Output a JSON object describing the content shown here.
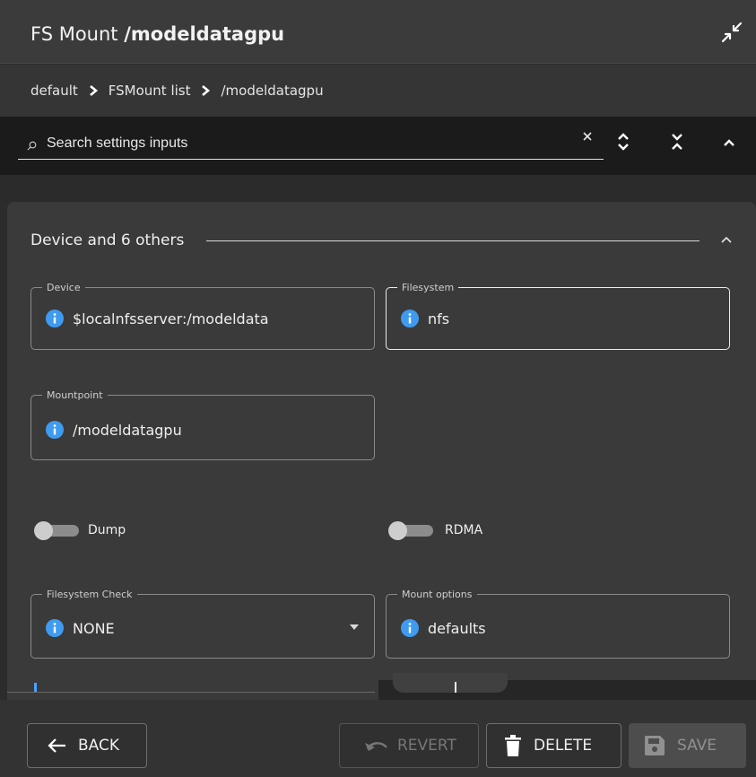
{
  "window": {
    "title_prefix": "FS Mount ",
    "title_name": "/modeldatagpu",
    "collapse_icon": "collapse-arrows-icon"
  },
  "breadcrumb": {
    "items": [
      "default",
      "FSMount list",
      "/modeldatagpu"
    ]
  },
  "search": {
    "placeholder": "Search settings inputs",
    "value": ""
  },
  "section": {
    "title": "Device and 6 others"
  },
  "fields": {
    "device": {
      "label": "Device",
      "value": "$localnfsserver:/modeldata"
    },
    "filesystem": {
      "label": "Filesystem",
      "value": "nfs"
    },
    "mountpoint": {
      "label": "Mountpoint",
      "value": "/modeldatagpu"
    },
    "filesystem_check": {
      "label": "Filesystem Check",
      "value": "NONE"
    },
    "mount_options": {
      "label": "Mount options",
      "value": "defaults"
    }
  },
  "toggles": {
    "dump": {
      "label": "Dump",
      "on": false
    },
    "rdma": {
      "label": "RDMA",
      "on": false
    }
  },
  "footer": {
    "back_label": "BACK",
    "revert_label": "REVERT",
    "delete_label": "DELETE",
    "save_label": "SAVE"
  },
  "colors": {
    "info_blue": "#3f9bf0",
    "panel": "#3a3a3a",
    "search_bar": "#1b1b1b"
  }
}
